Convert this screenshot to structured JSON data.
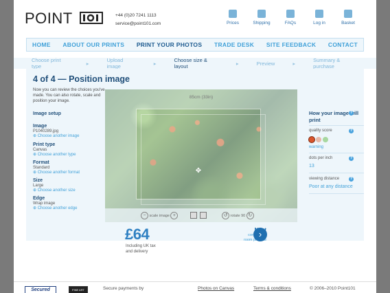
{
  "header": {
    "logo_text": "POINT",
    "logo_mark": "101",
    "phone": "+44 (0)20 7241 1113",
    "email": "service@point101.com",
    "topnav": [
      {
        "label": "Prices",
        "icon": "prices-icon"
      },
      {
        "label": "Shipping",
        "icon": "shipping-icon"
      },
      {
        "label": "FAQs",
        "icon": "faqs-icon"
      },
      {
        "label": "Log in",
        "icon": "login-icon"
      },
      {
        "label": "Basket",
        "icon": "basket-icon"
      }
    ]
  },
  "mainnav": [
    "HOME",
    "ABOUT OUR PRINTS",
    "PRINT YOUR PHOTOS",
    "TRADE DESK",
    "SITE FEEDBACK",
    "CONTACT"
  ],
  "mainnav_active": "PRINT YOUR PHOTOS",
  "steps": [
    "Choose print type",
    "Upload image",
    "Choose size & layout",
    "Preview",
    "Summary & purchase"
  ],
  "steps_current": "Choose size & layout",
  "step_separator": "▸",
  "page": {
    "title": "4 of 4 — Position image",
    "intro": "Now you can review the choices you've made. You can also rotate, scale and position your image."
  },
  "setup": {
    "title": "Image setup",
    "groups": [
      {
        "heading": "Image",
        "value": "P1040289.jpg",
        "link": "Choose another image"
      },
      {
        "heading": "Print type",
        "value": "Canvas",
        "link": "Choose another type"
      },
      {
        "heading": "Format",
        "value": "Standard",
        "link": "Choose another format"
      },
      {
        "heading": "Size",
        "value": "Large",
        "link": "Choose another size"
      },
      {
        "heading": "Edge",
        "value": "Wrap image",
        "link": "Choose another edge"
      }
    ]
  },
  "preview": {
    "size_label": "85cm (33in)",
    "scale_label": "scale image",
    "rotate_label": "rotate 90"
  },
  "print_info": {
    "title": "How your image will print",
    "quality_label": "quality score",
    "quality_value": "warning",
    "dpi_label": "dots per inch",
    "dpi_value": "13",
    "distance_label": "viewing distance",
    "distance_value": "Poor at any distance",
    "help_glyph": "?",
    "quality_colors": [
      "#d9542b",
      "#e8b8a8",
      "#a8d8a0"
    ]
  },
  "price": {
    "amount": "£64",
    "note_line1": "Including UK tax",
    "note_line2": "and delivery"
  },
  "next": {
    "label": "Next",
    "sub1": "continue to",
    "sub2": "room preview"
  },
  "footer": {
    "secured": "Secured",
    "fineart": "FINE ART",
    "secure_payments": "Secure payments by",
    "links": [
      "Photos on Canvas",
      "Terms & conditions"
    ],
    "copyright": "© 2006–2010 Point101"
  }
}
